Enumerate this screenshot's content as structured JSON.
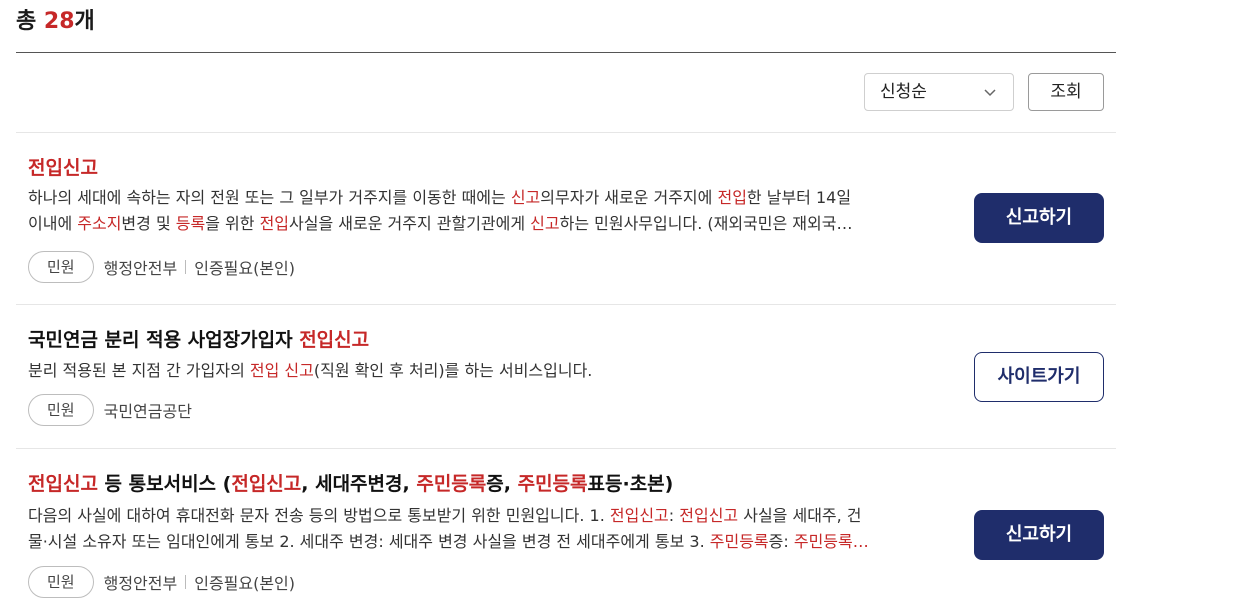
{
  "header": {
    "total_prefix": "총 ",
    "total_count": "28",
    "total_suffix": "개",
    "sort_selected": "신청순",
    "query_button": "조회"
  },
  "colors": {
    "highlight": "#c62828",
    "primary": "#1f2d6b"
  },
  "items": [
    {
      "title": [
        {
          "text": "전입신고",
          "hl": true
        }
      ],
      "desc_lines": [
        [
          {
            "text": "하나의 세대에 속하는 자의 전원 또는 그 일부가 거주지를 이동한 때에는 ",
            "hl": false
          },
          {
            "text": "신고",
            "hl": true
          },
          {
            "text": "의무자가 새로운 거주지에 ",
            "hl": false
          },
          {
            "text": "전입",
            "hl": true
          },
          {
            "text": "한 날부터 14일",
            "hl": false
          }
        ],
        [
          {
            "text": "이내에 ",
            "hl": false
          },
          {
            "text": "주소지",
            "hl": true
          },
          {
            "text": "변경 및 ",
            "hl": false
          },
          {
            "text": "등록",
            "hl": true
          },
          {
            "text": "을 위한 ",
            "hl": false
          },
          {
            "text": "전입",
            "hl": true
          },
          {
            "text": "사실을 새로운 거주지 관할기관에게 ",
            "hl": false
          },
          {
            "text": "신고",
            "hl": true
          },
          {
            "text": "하는 민원사무입니다. (재외국민은 재외국…",
            "hl": false
          }
        ]
      ],
      "tag": "민원",
      "meta": [
        "행정안전부",
        "인증필요(본인)"
      ],
      "action": "신고하기",
      "action_style": "primary"
    },
    {
      "title": [
        {
          "text": "국민연금 분리 적용 사업장가입자 ",
          "hl": false
        },
        {
          "text": "전입신고",
          "hl": true
        }
      ],
      "desc_lines": [
        [
          {
            "text": "분리 적용된 본 지점 간 가입자의 ",
            "hl": false
          },
          {
            "text": "전입 신고",
            "hl": true
          },
          {
            "text": "(직원 확인 후 처리)를 하는 서비스입니다.",
            "hl": false
          }
        ]
      ],
      "tag": "민원",
      "meta": [
        "국민연금공단"
      ],
      "action": "사이트가기",
      "action_style": "outline"
    },
    {
      "title": [
        {
          "text": "전입신고",
          "hl": true
        },
        {
          "text": " 등 통보서비스 (",
          "hl": false
        },
        {
          "text": "전입신고",
          "hl": true
        },
        {
          "text": ", 세대주변경, ",
          "hl": false
        },
        {
          "text": "주민등록",
          "hl": true
        },
        {
          "text": "증, ",
          "hl": false
        },
        {
          "text": "주민등록",
          "hl": true
        },
        {
          "text": "표등·초본)",
          "hl": false
        }
      ],
      "desc_lines": [
        [
          {
            "text": "다음의 사실에 대하여 휴대전화 문자 전송 등의 방법으로 통보받기 위한 민원입니다. 1. ",
            "hl": false
          },
          {
            "text": "전입신고",
            "hl": true
          },
          {
            "text": ": ",
            "hl": false
          },
          {
            "text": "전입신고",
            "hl": true
          },
          {
            "text": " 사실을 세대주, 건",
            "hl": false
          }
        ],
        [
          {
            "text": "물·시설 소유자 또는 임대인에게 통보 2. 세대주 변경: 세대주 변경 사실을 변경 전 세대주에게 통보 3. ",
            "hl": false
          },
          {
            "text": "주민등록",
            "hl": true
          },
          {
            "text": "증: ",
            "hl": false
          },
          {
            "text": "주민등록…",
            "hl": true
          }
        ]
      ],
      "tag": "민원",
      "meta": [
        "행정안전부",
        "인증필요(본인)"
      ],
      "action": "신고하기",
      "action_style": "primary"
    }
  ]
}
